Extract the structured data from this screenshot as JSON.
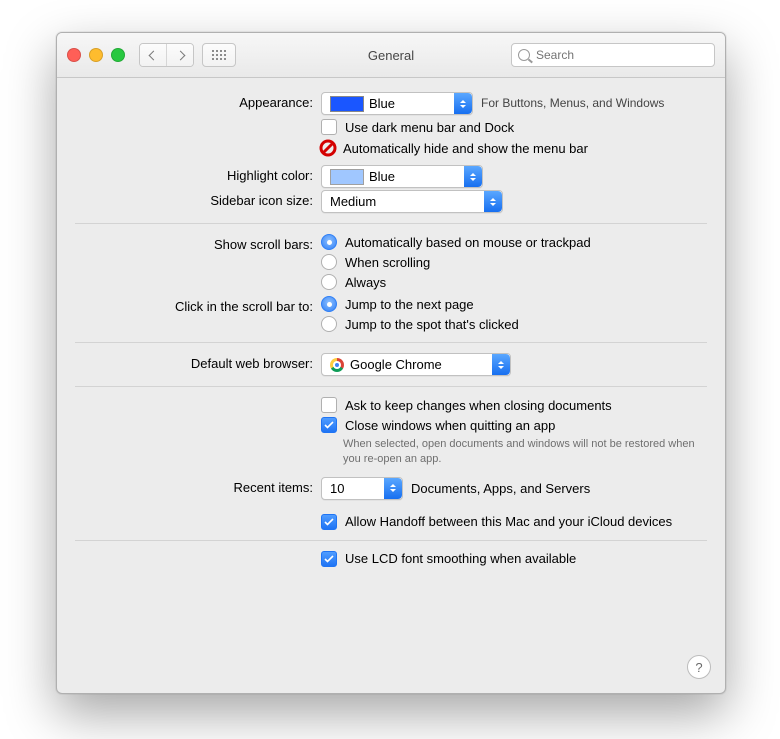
{
  "window": {
    "title": "General"
  },
  "toolbar": {
    "search_placeholder": "Search"
  },
  "appearance": {
    "label": "Appearance:",
    "value": "Blue",
    "note": "For Buttons, Menus, and Windows",
    "dark_menu": {
      "label": "Use dark menu bar and Dock",
      "checked": false
    },
    "auto_hide": {
      "label": "Automatically hide and show the menu bar",
      "checked": false
    }
  },
  "highlight": {
    "label": "Highlight color:",
    "value": "Blue"
  },
  "sidebar": {
    "label": "Sidebar icon size:",
    "value": "Medium"
  },
  "scrollbars": {
    "label": "Show scroll bars:",
    "options": {
      "auto": "Automatically based on mouse or trackpad",
      "scrolling": "When scrolling",
      "always": "Always"
    },
    "selected": "auto"
  },
  "scrollclick": {
    "label": "Click in the scroll bar to:",
    "options": {
      "next": "Jump to the next page",
      "spot": "Jump to the spot that's clicked"
    },
    "selected": "next"
  },
  "browser": {
    "label": "Default web browser:",
    "value": "Google Chrome"
  },
  "documents": {
    "ask": {
      "label": "Ask to keep changes when closing documents",
      "checked": false
    },
    "close": {
      "label": "Close windows when quitting an app",
      "checked": true
    },
    "close_note": "When selected, open documents and windows will not be restored when you re-open an app."
  },
  "recent": {
    "label": "Recent items:",
    "value": "10",
    "note": "Documents, Apps, and Servers"
  },
  "handoff": {
    "label": "Allow Handoff between this Mac and your iCloud devices",
    "checked": true
  },
  "lcd": {
    "label": "Use LCD font smoothing when available",
    "checked": true
  }
}
